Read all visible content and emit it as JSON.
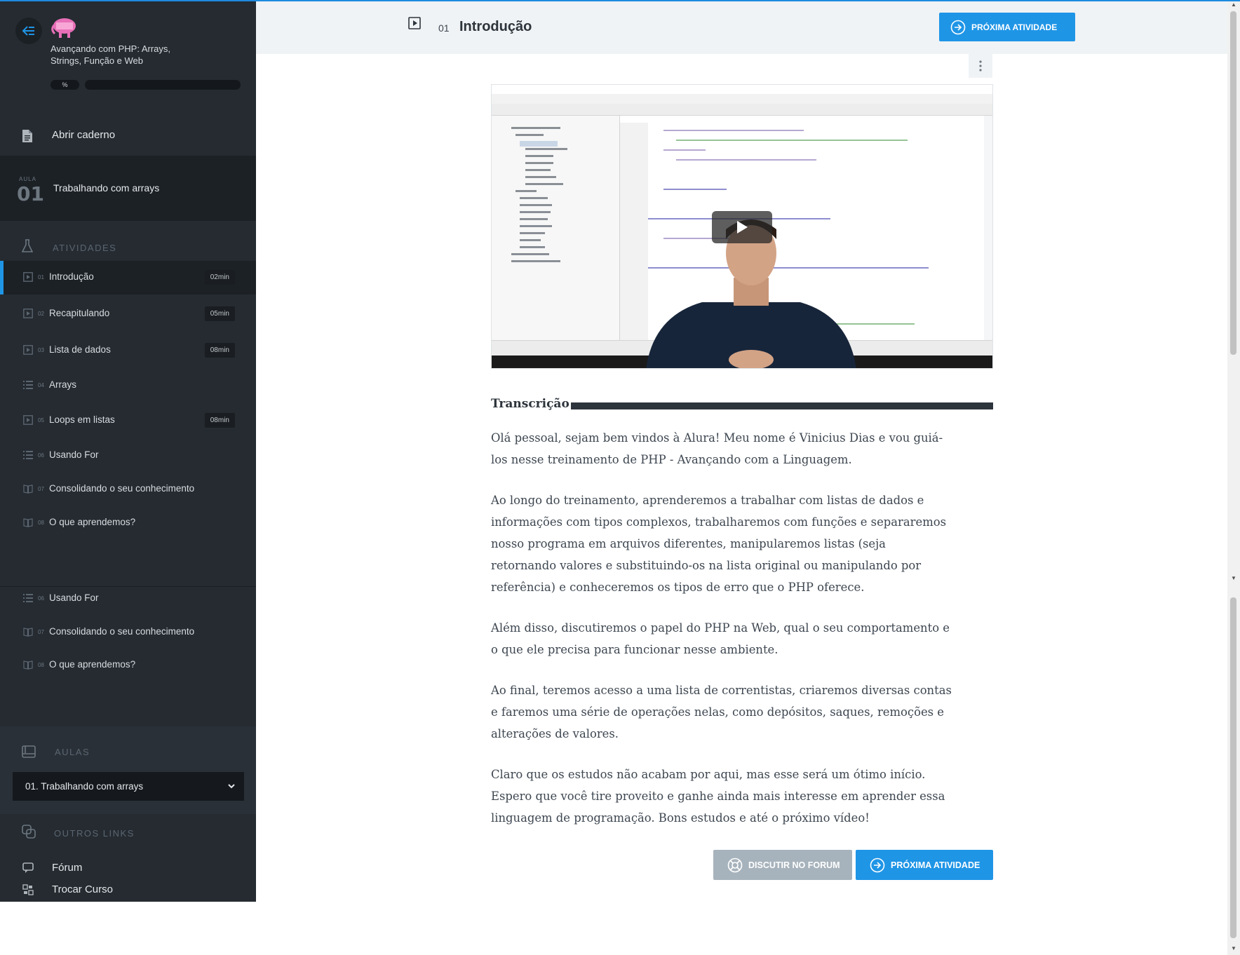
{
  "course": {
    "title": "Avançando com PHP: Arrays, Strings, Função e Web",
    "progress_label": "%",
    "progress_value": 0
  },
  "sidebar": {
    "notebook_label": "Abrir caderno",
    "aula_small": "AULA",
    "aula_number": "01",
    "aula_title": "Trabalhando com arrays",
    "activities_header": "ATIVIDADES",
    "activities": [
      {
        "num": "01",
        "title": "Introdução",
        "duration": "02min",
        "icon": "video-icon",
        "active": true
      },
      {
        "num": "02",
        "title": "Recapitulando",
        "duration": "05min",
        "icon": "video-icon"
      },
      {
        "num": "03",
        "title": "Lista de dados",
        "duration": "08min",
        "icon": "video-icon"
      },
      {
        "num": "04",
        "title": "Arrays",
        "duration": "",
        "icon": "list-icon"
      },
      {
        "num": "05",
        "title": "Loops em listas",
        "duration": "08min",
        "icon": "video-icon"
      },
      {
        "num": "06",
        "title": "Usando For",
        "duration": "",
        "icon": "list-icon"
      },
      {
        "num": "07",
        "title": "Consolidando o seu conhecimento",
        "duration": "",
        "icon": "book-icon"
      },
      {
        "num": "08",
        "title": "O que aprendemos?",
        "duration": "",
        "icon": "book-icon"
      }
    ],
    "activities_repeat": [
      {
        "num": "06",
        "title": "Usando For",
        "icon": "list-icon"
      },
      {
        "num": "07",
        "title": "Consolidando o seu conhecimento",
        "icon": "book-icon"
      },
      {
        "num": "08",
        "title": "O que aprendemos?",
        "icon": "book-icon"
      }
    ],
    "aulas_header": "AULAS",
    "aula_select_value": "01. Trabalhando com arrays",
    "links_header": "OUTROS LINKS",
    "links": [
      {
        "label": "Fórum",
        "icon": "chat-icon"
      },
      {
        "label": "Trocar Curso",
        "icon": "switch-icon"
      }
    ]
  },
  "header": {
    "activity_number": "01",
    "activity_title": "Introdução",
    "next_button": "PRÓXIMA ATIVIDADE"
  },
  "transcript": {
    "header": "Transcrição",
    "paragraphs": [
      "Olá pessoal, sejam bem vindos à Alura! Meu nome é Vinicius Dias e vou guiá-los nesse treinamento de PHP - Avançando com a Linguagem.",
      "Ao longo do treinamento, aprenderemos a trabalhar com listas de dados e informações com tipos complexos, trabalharemos com funções e separaremos nosso programa em arquivos diferentes, manipularemos listas (seja retornando valores e substituindo-os na lista original ou manipulando por referência) e conheceremos os tipos de erro que o PHP oferece.",
      "Além disso, discutiremos o papel do PHP na Web, qual o seu comportamento e o que ele precisa para funcionar nesse ambiente.",
      "Ao final, teremos acesso a uma lista de correntistas, criaremos diversas contas e faremos uma série de operações nelas, como depósitos, saques, remoções e alterações de valores.",
      "Claro que os estudos não acabam por aqui, mas esse será um ótimo início. Espero que você tire proveito e ganhe ainda mais interesse em aprender essa linguagem de programação. Bons estudos e até o próximo vídeo!"
    ]
  },
  "footer_buttons": {
    "forum": "DISCUTIR NO FORUM",
    "next": "PRÓXIMA ATIVIDADE"
  },
  "colors": {
    "sidebar_bg": "#252b31",
    "accent": "#1f95e6",
    "header_bg": "#f0f3f5"
  }
}
